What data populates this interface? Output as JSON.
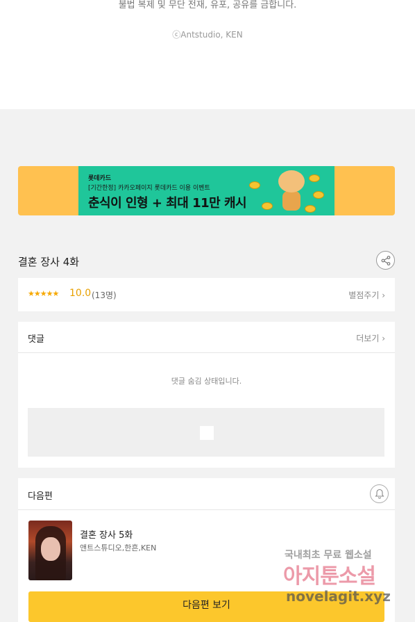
{
  "footer": {
    "notice": "불법 복제 및 무단 전재, 유포, 공유를 금합니다.",
    "copyright": "ⓒAntstudio, KEN"
  },
  "banner": {
    "brand": "롯데카드",
    "sub": "[기간한정] 카카오페이지 롯데카드 이용 이벤트",
    "main": "춘식이 인형 + 최대 11만 캐시",
    "bg_color": "#ffc150",
    "inner_color": "#1fc69a"
  },
  "episode": {
    "title": "결혼 장사 4화",
    "share_icon": "share-icon"
  },
  "rating": {
    "stars": "★★★★★",
    "value": "10.0",
    "count": "(13명)",
    "rate_link": "별점주기 ›"
  },
  "comments": {
    "title": "댓글",
    "more": "더보기 ›",
    "hidden_message": "댓글 숨김 상태입니다."
  },
  "next": {
    "title": "다음편",
    "episode_title": "결혼 장사 5화",
    "authors": "앤트스튜디오,한흔,KEN",
    "button": "다음편 보기"
  },
  "watermark": {
    "line1": "국내최초 무료 웹소설",
    "line2": "아지툰소설",
    "line3": "novelagit.xyz"
  }
}
